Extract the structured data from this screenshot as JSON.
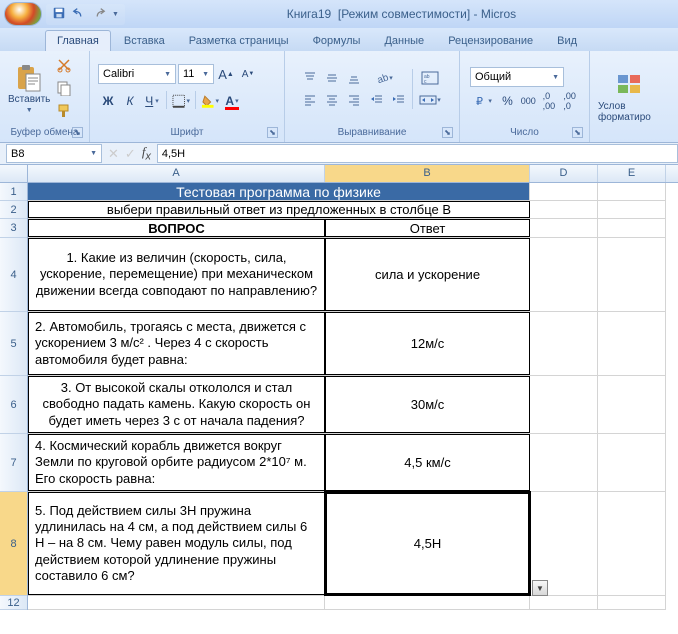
{
  "title": {
    "doc": "Книга19",
    "mode": "[Режим совместимости]",
    "app": "- Micros"
  },
  "tabs": [
    "Главная",
    "Вставка",
    "Разметка страницы",
    "Формулы",
    "Данные",
    "Рецензирование",
    "Вид"
  ],
  "ribbon": {
    "clipboard": {
      "paste": "Вставить",
      "label": "Буфер обмена"
    },
    "font": {
      "name": "Calibri",
      "size": "11",
      "label": "Шрифт"
    },
    "alignment": {
      "label": "Выравнивание"
    },
    "number": {
      "format": "Общий",
      "label": "Число"
    },
    "styles": {
      "cond": "Услов\nформатиро"
    }
  },
  "formula": {
    "name_box": "B8",
    "value": "4,5Н"
  },
  "cols": {
    "A": 297,
    "B": 205,
    "D": 68,
    "E": 68
  },
  "rows": {
    "1": 18,
    "2": 18,
    "3": 19,
    "4": 74,
    "5": 64,
    "6": 58,
    "7": 58,
    "8": 104,
    "12": 14
  },
  "sheet": {
    "title": "Тестовая программа по физике",
    "subtitle": "выбери правильный ответ из предложенных в столбце В",
    "h_a": "ВОПРОС",
    "h_b": "Ответ",
    "rows": [
      {
        "q": "1. Какие из величин (скорость, сила, ускорение, перемещение) при механическом движении всегда совподают по направлению?",
        "a": "сила и ускорение"
      },
      {
        "q": "2. Автомобиль, трогаясь с места, движется с ускорением 3 м/с² . Через 4 с скорость автомобиля будет равна:",
        "a": "12м/с"
      },
      {
        "q": "3. От высокой скалы откололся и стал свободно падать камень. Какую скорость он будет иметь через 3 с от начала падения?",
        "a": "30м/с"
      },
      {
        "q": "4. Космический корабль движется вокруг Земли по круговой орбите радиусом 2*10⁷ м. Его скорость равна:",
        "a": "4,5 км/с"
      },
      {
        "q": "5. Под действием силы 3Н пружина удлинилась на 4 см, а под действием силы 6 Н – на 8 см. Чему равен модуль силы, под действием  которой удлинение пружины составило 6 см?",
        "a": "4,5Н"
      }
    ]
  }
}
